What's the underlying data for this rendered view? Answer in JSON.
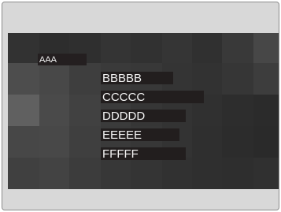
{
  "header_label": "AAA",
  "menu": {
    "items": [
      {
        "label": "BBBBB"
      },
      {
        "label": "CCCCC"
      },
      {
        "label": "DDDDD"
      },
      {
        "label": "EEEEE"
      },
      {
        "label": "FFFFF"
      }
    ]
  }
}
